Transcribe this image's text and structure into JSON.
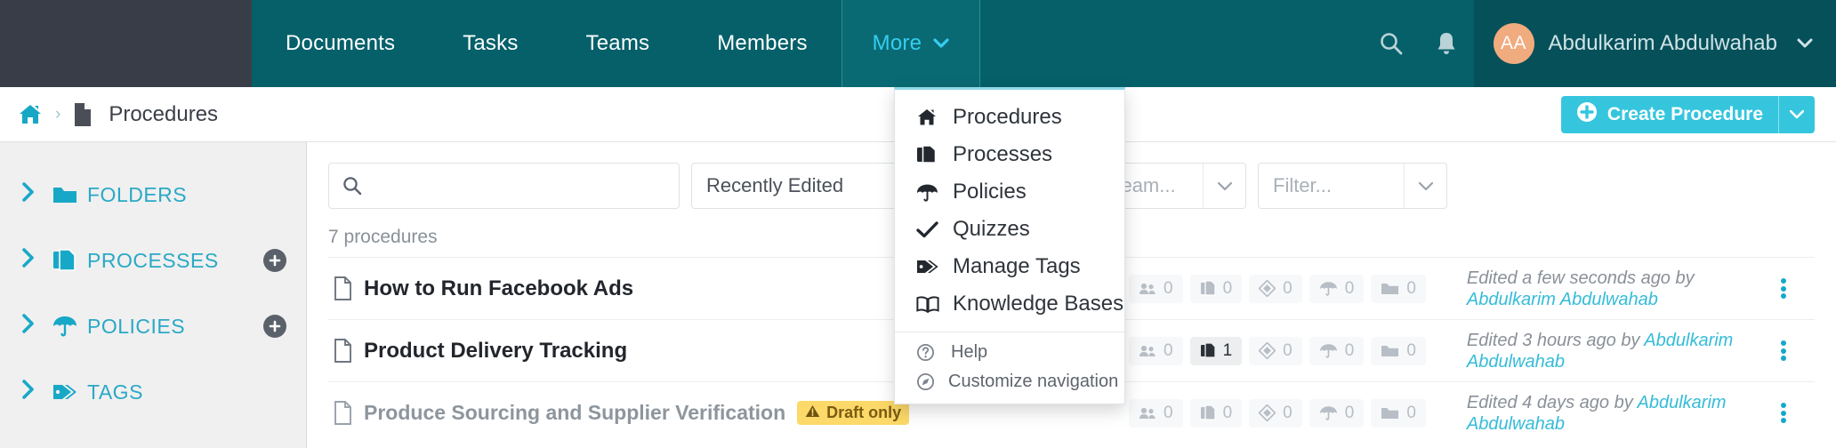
{
  "topnav": {
    "items": [
      {
        "label": "Documents",
        "active": false
      },
      {
        "label": "Tasks",
        "active": false
      },
      {
        "label": "Teams",
        "active": false
      },
      {
        "label": "Members",
        "active": false
      },
      {
        "label": "More",
        "active": true
      }
    ],
    "search_icon": "search-icon",
    "bell_icon": "notifications-bell-icon",
    "user": {
      "initials": "AA",
      "name": "Abdulkarim Abdulwahab",
      "caret": "⌄"
    },
    "colors": {
      "bar": "#056069",
      "brand_block": "#383d47",
      "active_item_text": "#35cdf0",
      "avatar": "#f0ab7e"
    }
  },
  "breadcrumb": {
    "home_icon": "home-icon",
    "separator": "›",
    "doc_icon": "document-icon",
    "current": "Procedures"
  },
  "create_button": {
    "label": "Create Procedure",
    "plus_icon": "plus-circle-icon",
    "caret": "▾",
    "color": "#35c6de"
  },
  "sidebar": {
    "items": [
      {
        "label": "FOLDERS",
        "icon": "folder-icon",
        "add": false
      },
      {
        "label": "PROCESSES",
        "icon": "copy-documents-icon",
        "add": true
      },
      {
        "label": "POLICIES",
        "icon": "umbrella-icon",
        "add": true
      },
      {
        "label": "TAGS",
        "icon": "tags-icon",
        "add": false
      }
    ],
    "chevron": "›",
    "add_glyph": "+"
  },
  "filters": {
    "search_placeholder": "",
    "search_value": "",
    "sort_value": "Recently Edited",
    "team_placeholder": "Filter by team...",
    "filter_placeholder": "Filter...",
    "caret": "⌄"
  },
  "list": {
    "count_text": "7 procedures",
    "rows": [
      {
        "title": "How to Run Facebook Ads",
        "draft": false,
        "draft_label": "",
        "metrics": [
          {
            "icon": "members-icon",
            "value": "0",
            "highlight": false
          },
          {
            "icon": "processes-icon",
            "value": "0",
            "highlight": false
          },
          {
            "icon": "quizzes-icon",
            "value": "0",
            "highlight": false
          },
          {
            "icon": "policies-icon",
            "value": "0",
            "highlight": false
          },
          {
            "icon": "folders-icon",
            "value": "0",
            "highlight": false
          }
        ],
        "edited_prefix": "Edited a few seconds ago by ",
        "edited_by": "Abdulkarim Abdulwahab"
      },
      {
        "title": "Product Delivery Tracking",
        "draft": false,
        "draft_label": "",
        "metrics": [
          {
            "icon": "members-icon",
            "value": "0",
            "highlight": false
          },
          {
            "icon": "processes-icon",
            "value": "1",
            "highlight": true
          },
          {
            "icon": "quizzes-icon",
            "value": "0",
            "highlight": false
          },
          {
            "icon": "policies-icon",
            "value": "0",
            "highlight": false
          },
          {
            "icon": "folders-icon",
            "value": "0",
            "highlight": false
          }
        ],
        "edited_prefix": "Edited 3 hours ago by ",
        "edited_by": "Abdulkarim Abdulwahab"
      },
      {
        "title": "Produce Sourcing and Supplier Verification",
        "draft": true,
        "draft_label": "Draft only",
        "metrics": [
          {
            "icon": "members-icon",
            "value": "0",
            "highlight": false
          },
          {
            "icon": "processes-icon",
            "value": "0",
            "highlight": false
          },
          {
            "icon": "quizzes-icon",
            "value": "0",
            "highlight": false
          },
          {
            "icon": "policies-icon",
            "value": "0",
            "highlight": false
          },
          {
            "icon": "folders-icon",
            "value": "0",
            "highlight": false
          }
        ],
        "edited_prefix": "Edited 4 days ago by ",
        "edited_by": "Abdulkarim Abdulwahab"
      }
    ],
    "kebab_icon": "more-options-icon",
    "draft_warning_icon": "warning-triangle-icon"
  },
  "menu": {
    "items": [
      {
        "label": "Procedures",
        "icon": "home-icon"
      },
      {
        "label": "Processes",
        "icon": "copy-documents-icon"
      },
      {
        "label": "Policies",
        "icon": "umbrella-icon"
      },
      {
        "label": "Quizzes",
        "icon": "check-icon"
      },
      {
        "label": "Manage Tags",
        "icon": "tag-icon"
      },
      {
        "label": "Knowledge Bases",
        "icon": "book-icon"
      }
    ],
    "footer_items": [
      {
        "label": "Help",
        "icon": "question-circle-icon"
      },
      {
        "label": "Customize navigation",
        "icon": "compass-icon"
      }
    ]
  }
}
